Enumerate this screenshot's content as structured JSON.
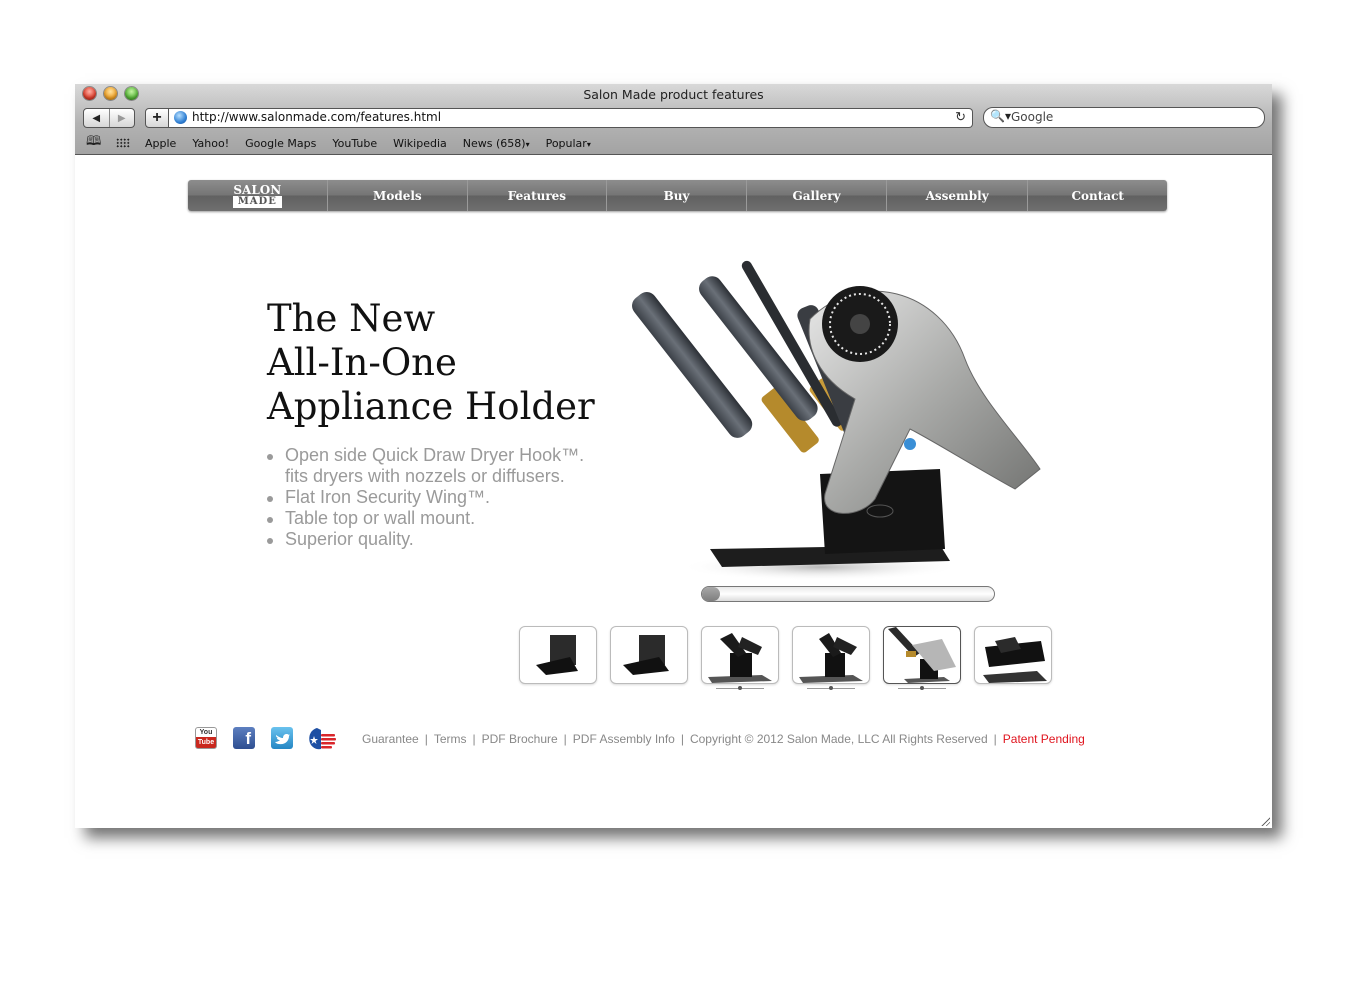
{
  "window": {
    "title": "Salon Made product features"
  },
  "toolbar": {
    "back_icon": "◀",
    "forward_icon": "▶",
    "add_icon": "+",
    "url": "http://www.salonmade.com/features.html",
    "reload_icon": "↻",
    "search_placeholder": "Google",
    "search_icon": "🔍▾"
  },
  "bookmarks": {
    "reading_list_icon": "🕮",
    "items": [
      {
        "label": "Apple"
      },
      {
        "label": "Yahoo!"
      },
      {
        "label": "Google Maps"
      },
      {
        "label": "YouTube"
      },
      {
        "label": "Wikipedia"
      },
      {
        "label": "News (658)",
        "dropdown": "▾"
      },
      {
        "label": "Popular",
        "dropdown": "▾"
      }
    ]
  },
  "site_nav": {
    "logo_top": "SALON",
    "logo_bottom": "MADE",
    "items": [
      {
        "label": "Models"
      },
      {
        "label": "Features"
      },
      {
        "label": "Buy"
      },
      {
        "label": "Gallery"
      },
      {
        "label": "Assembly"
      },
      {
        "label": "Contact"
      }
    ]
  },
  "hero": {
    "headline_lines": [
      "The New",
      "All-In-One",
      "Appliance Holder"
    ],
    "bullets": [
      "Open side Quick Draw Dryer Hook™. fits dryers with nozzels or diffusers.",
      "Flat Iron Security Wing™.",
      "Table top or wall mount.",
      "Superior quality."
    ],
    "bullet_lines": [
      [
        "Open side Quick Draw Dryer Hook™.",
        "fits dryers with nozzels or diffusers."
      ],
      [
        "Flat Iron Security Wing™."
      ],
      [
        "Table top or wall mount."
      ],
      [
        "Superior quality."
      ]
    ],
    "image_alt": "Appliance holder with curling irons, flat iron and hair dryer",
    "slider_position": 0.0
  },
  "thumbnails": [
    {
      "name": "wall-mount-empty",
      "active": false,
      "has_video_control": false
    },
    {
      "name": "wall-mount-angle",
      "active": false,
      "has_video_control": false
    },
    {
      "name": "table-top-front",
      "active": false,
      "has_video_control": true
    },
    {
      "name": "table-top-side",
      "active": false,
      "has_video_control": true
    },
    {
      "name": "loaded-with-appliances",
      "active": true,
      "has_video_control": true
    },
    {
      "name": "table-top-rear",
      "active": false,
      "has_video_control": false
    }
  ],
  "footer": {
    "social": [
      {
        "name": "youtube",
        "label_top": "You",
        "label_bottom": "Tube"
      },
      {
        "name": "facebook",
        "glyph": "f"
      },
      {
        "name": "twitter",
        "glyph": "🐦"
      },
      {
        "name": "made-in-usa"
      }
    ],
    "links": [
      {
        "label": "Guarantee"
      },
      {
        "label": "Terms"
      },
      {
        "label": "PDF Brochure"
      },
      {
        "label": "PDF Assembly Info"
      }
    ],
    "copyright": "Copyright © 2012 Salon Made, LLC All Rights Reserved",
    "patent": "Patent Pending",
    "separator": "|",
    "patent_color": "#e0141e"
  }
}
